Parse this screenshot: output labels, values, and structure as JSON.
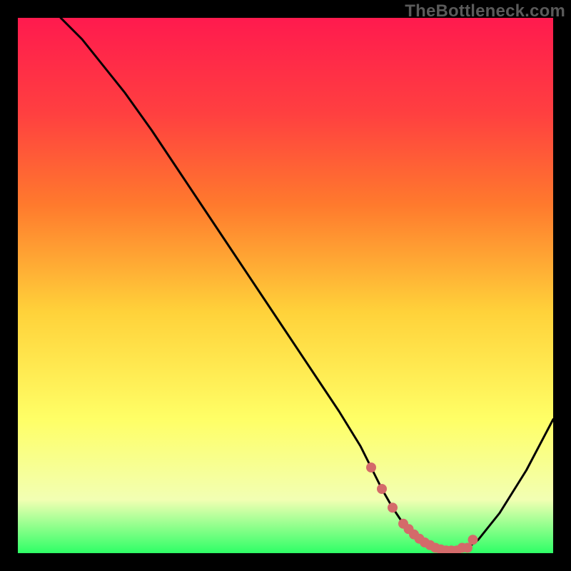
{
  "watermark": "TheBottleneck.com",
  "colors": {
    "background": "#000000",
    "gradient_top": "#ff1a4e",
    "gradient_mid_upper": "#ff7a2d",
    "gradient_mid": "#ffd23a",
    "gradient_mid_lower": "#ffff66",
    "gradient_lower": "#f2ffb3",
    "gradient_bottom": "#2eff66",
    "curve_stroke": "#000000",
    "marker_fill": "#d46a6a",
    "marker_stroke": "#d46a6a"
  },
  "chart_data": {
    "type": "line",
    "title": "",
    "xlabel": "",
    "ylabel": "",
    "xlim": [
      0,
      100
    ],
    "ylim": [
      0,
      100
    ],
    "grid": false,
    "legend": false,
    "series": [
      {
        "name": "bottleneck-curve",
        "x": [
          8,
          12,
          16,
          20,
          25,
          30,
          35,
          40,
          45,
          50,
          55,
          60,
          64,
          66,
          68,
          70,
          72,
          74,
          76,
          78,
          80,
          82,
          84,
          86,
          90,
          95,
          100
        ],
        "y": [
          100,
          96,
          91,
          86,
          79,
          71.5,
          64,
          56.5,
          49,
          41.5,
          34,
          26.5,
          20,
          16,
          12,
          8.5,
          5.5,
          3.5,
          2,
          1,
          0.5,
          0.5,
          1,
          2.5,
          7.5,
          15.5,
          25
        ]
      }
    ],
    "scatter": {
      "name": "optimal-region-markers",
      "x": [
        66,
        68,
        70,
        72,
        73,
        74,
        75,
        76,
        77,
        78,
        79,
        80,
        81,
        82,
        83,
        84,
        85
      ],
      "y": [
        16,
        12,
        8.5,
        5.5,
        4.5,
        3.5,
        2.7,
        2,
        1.5,
        1,
        0.7,
        0.5,
        0.5,
        0.5,
        1,
        1,
        2.5
      ]
    }
  }
}
